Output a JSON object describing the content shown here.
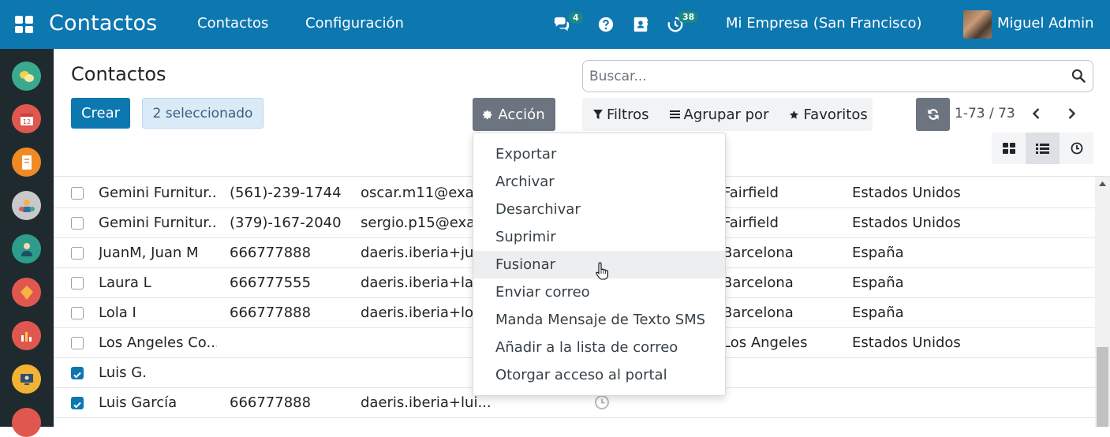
{
  "topbar": {
    "brand": "Contactos",
    "menu": [
      "Contactos",
      "Configuración"
    ],
    "chat_badge": "4",
    "activity_badge": "38",
    "company": "Mi Empresa (San Francisco)",
    "user": "Miguel Admin"
  },
  "control_panel": {
    "title": "Contactos",
    "create_label": "Crear",
    "selected_label": "2 seleccionado",
    "action_label": "Acción",
    "search_placeholder": "Buscar...",
    "filters_label": "Filtros",
    "groupby_label": "Agrupar por",
    "favorites_label": "Favoritos",
    "pager": "1-73 / 73"
  },
  "action_menu": [
    "Exportar",
    "Archivar",
    "Desarchivar",
    "Suprimir",
    "Fusionar",
    "Enviar correo",
    "Manda Mensaje de Texto SMS",
    "Añadir a la lista de correo",
    "Otorgar acceso al portal"
  ],
  "rows": [
    {
      "name": "Gemini Furnitur...",
      "phone": "(561)-239-1744",
      "email": "oscar.m11@exa...",
      "city": "Fairfield",
      "country": "Estados Unidos",
      "checked": false
    },
    {
      "name": "Gemini Furnitur...",
      "phone": "(379)-167-2040",
      "email": "sergio.p15@exa...",
      "city": "Fairfield",
      "country": "Estados Unidos",
      "checked": false
    },
    {
      "name": "JuanM, Juan M",
      "phone": "666777888",
      "email": "daeris.iberia+ju...",
      "city": "Barcelona",
      "country": "España",
      "checked": false
    },
    {
      "name": "Laura L",
      "phone": "666777555",
      "email": "daeris.iberia+la...",
      "city": "Barcelona",
      "country": "España",
      "checked": false
    },
    {
      "name": "Lola I",
      "phone": "666777888",
      "email": "daeris.iberia+lol...",
      "city": "Barcelona",
      "country": "España",
      "checked": false
    },
    {
      "name": "Los Angeles Co...",
      "phone": "",
      "email": "",
      "city": "Los Angeles",
      "country": "Estados Unidos",
      "checked": false
    },
    {
      "name": "Luis G.",
      "phone": "",
      "email": "",
      "city": "",
      "country": "",
      "checked": true
    },
    {
      "name": "Luis García",
      "phone": "666777888",
      "email": "daeris.iberia+lui...",
      "city": "",
      "country": "",
      "checked": true
    }
  ],
  "colors": {
    "primary": "#0d77b0",
    "sidebar": "#1f2a2e",
    "action_button": "#6c7480"
  }
}
